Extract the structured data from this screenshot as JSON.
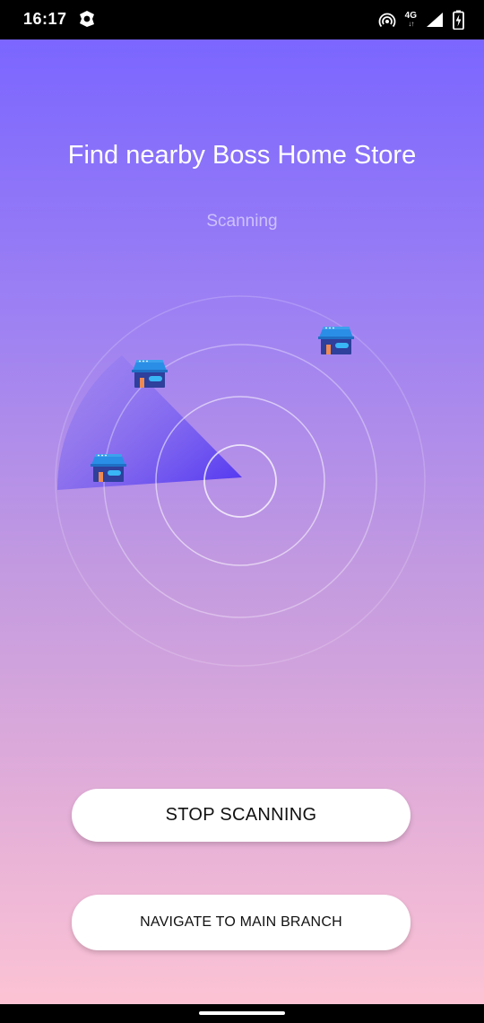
{
  "status_bar": {
    "time": "16:17",
    "network": "4G",
    "icons": [
      "app-notification-icon",
      "hotspot-icon",
      "signal-icon",
      "battery-charging-icon"
    ]
  },
  "main": {
    "title": "Find nearby Boss Home Store",
    "status": "Scanning"
  },
  "radar": {
    "store_icon": "store-icon",
    "rings": 4
  },
  "buttons": {
    "stop_label": "STOP SCANNING",
    "navigate_label": "NAVIGATE TO MAIN BRANCH"
  },
  "colors": {
    "gradient_top": "#7b66ff",
    "gradient_bottom": "#fcc3d4",
    "sweep": "#5a3df5",
    "store_roof": "#2a8ee6",
    "store_body": "#2e3f9c"
  }
}
